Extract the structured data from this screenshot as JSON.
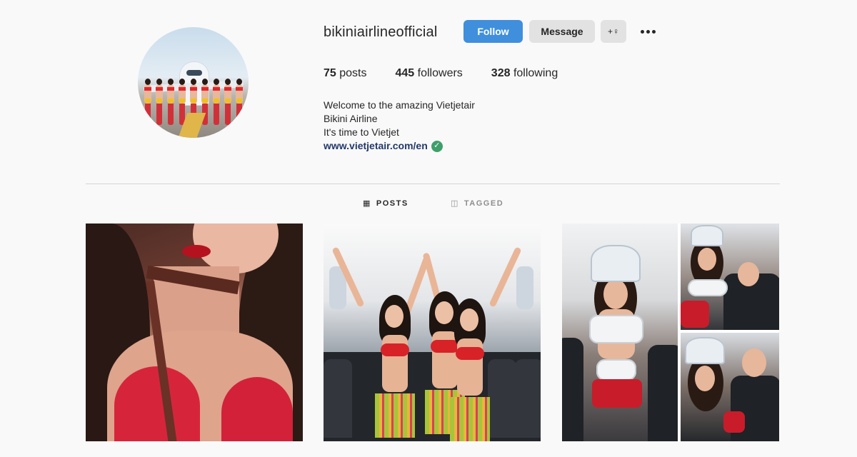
{
  "profile": {
    "username": "bikiniairlineofficial",
    "follow_label": "Follow",
    "message_label": "Message",
    "suggest_label": "+♀",
    "stats": [
      {
        "count": "75",
        "label": "posts"
      },
      {
        "count": "445",
        "label": "followers"
      },
      {
        "count": "328",
        "label": "following"
      }
    ],
    "bio": {
      "line1": "Welcome to the amazing Vietjetair",
      "line2": "Bikini Airline",
      "line3": "It's time to Vietjet",
      "link": "www.vietjetair.com/en",
      "verified_glyph": "✓"
    }
  },
  "tabs": [
    {
      "icon": "grid-icon",
      "glyph": "▦",
      "label": "POSTS",
      "active": true
    },
    {
      "icon": "tag-icon",
      "glyph": "◫",
      "label": "TAGGED",
      "active": false
    }
  ],
  "posts": [
    {
      "name": "post-red-bikini-closeup"
    },
    {
      "name": "post-cabin-dancers"
    },
    {
      "name": "post-crown-collage"
    }
  ],
  "colors": {
    "follow_bg": "#3f8fdc",
    "button_gray": "#e2e2e2",
    "link": "#22396b",
    "verified": "#3e9f6b",
    "divider": "#d5d5d5"
  }
}
